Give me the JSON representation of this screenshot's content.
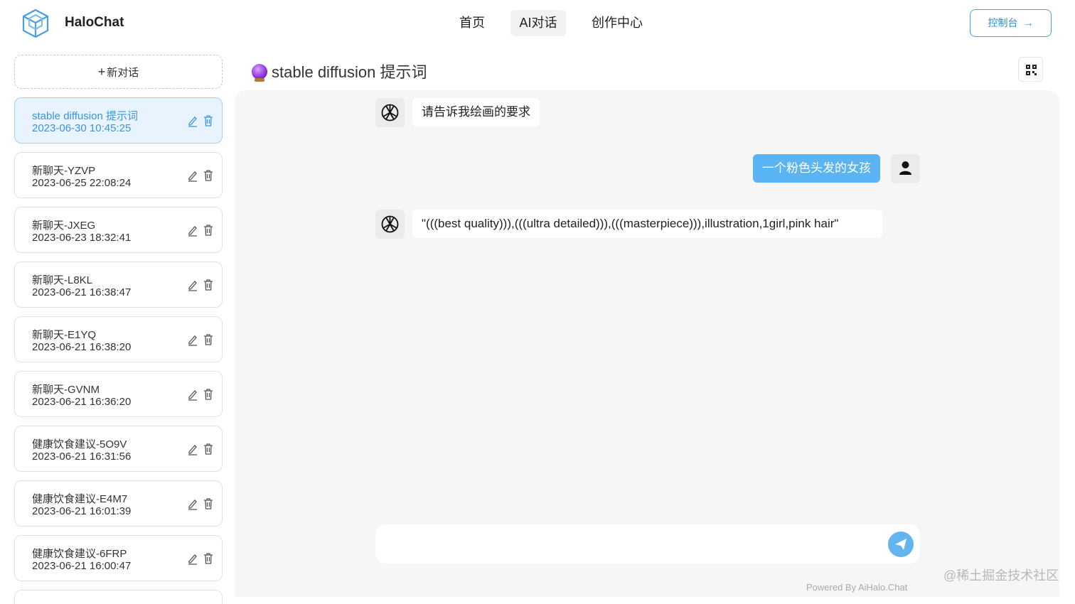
{
  "app": {
    "brand": "HaloChat"
  },
  "nav": {
    "items": [
      {
        "label": "首页"
      },
      {
        "label": "AI对话"
      },
      {
        "label": "创作中心"
      }
    ],
    "console_label": "控制台"
  },
  "sidebar": {
    "new_chat_label": "新对话",
    "conversations": [
      {
        "title": "stable diffusion 提示词",
        "time": "2023-06-30 10:45:25"
      },
      {
        "title": "新聊天-YZVP",
        "time": "2023-06-25 22:08:24"
      },
      {
        "title": "新聊天-JXEG",
        "time": "2023-06-23 18:32:41"
      },
      {
        "title": "新聊天-L8KL",
        "time": "2023-06-21 16:38:47"
      },
      {
        "title": "新聊天-E1YQ",
        "time": "2023-06-21 16:38:20"
      },
      {
        "title": "新聊天-GVNM",
        "time": "2023-06-21 16:36:20"
      },
      {
        "title": "健康饮食建议-5O9V",
        "time": "2023-06-21 16:31:56"
      },
      {
        "title": "健康饮食建议-E4M7",
        "time": "2023-06-21 16:01:39"
      },
      {
        "title": "健康饮食建议-6FRP",
        "time": "2023-06-21 16:00:47"
      }
    ]
  },
  "chat": {
    "title": "stable diffusion 提示词",
    "messages": [
      {
        "role": "assistant",
        "text": "请告诉我绘画的要求"
      },
      {
        "role": "user",
        "text": "一个粉色头发的女孩"
      },
      {
        "role": "assistant",
        "text": "\"(((best quality))),(((ultra detailed))),(((masterpiece))),illustration,1girl,pink hair\""
      }
    ],
    "input_value": "",
    "powered_by": "Powered By AiHalo.Chat"
  },
  "watermark": "@稀土掘金技术社区",
  "colors": {
    "accent": "#3d95de",
    "user_bubble": "#5ab3f2",
    "panel_bg": "#f6f6f6"
  }
}
